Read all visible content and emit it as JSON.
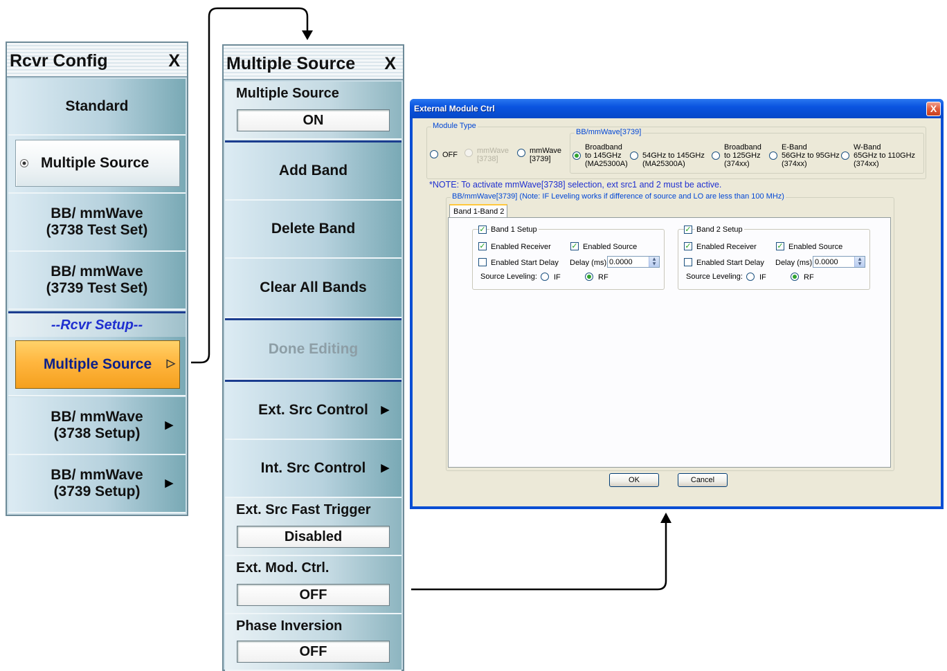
{
  "menu1": {
    "title": "Rcvr Config",
    "close": "X",
    "standard": "Standard",
    "multiple_source": "Multiple Source",
    "bb_3738_test": "BB/ mmWave\n(3738 Test Set)",
    "bb_3739_test": "BB/ mmWave\n(3739 Test Set)",
    "section_header": "--Rcvr Setup--",
    "multiple_source_setup": "Multiple Source",
    "bb_3738_setup": "BB/ mmWave\n(3738 Setup)",
    "bb_3739_setup": "BB/ mmWave\n(3739 Setup)"
  },
  "menu2": {
    "title": "Multiple Source",
    "close": "X",
    "multiple_source_label": "Multiple Source",
    "multiple_source_value": "ON",
    "add_band": "Add Band",
    "delete_band": "Delete Band",
    "clear_all_bands": "Clear All Bands",
    "done_editing": "Done Editing",
    "ext_src_control": "Ext. Src Control",
    "int_src_control": "Int. Src Control",
    "ext_src_fast_trigger_label": "Ext. Src Fast Trigger",
    "ext_src_fast_trigger_value": "Disabled",
    "ext_mod_ctrl_label": "Ext. Mod. Ctrl.",
    "ext_mod_ctrl_value": "OFF",
    "phase_inversion_label": "Phase Inversion",
    "phase_inversion_value": "OFF"
  },
  "dialog": {
    "title": "External Module Ctrl",
    "close": "X",
    "module_type": {
      "title": "Module Type",
      "off": "OFF",
      "mmwave_3738": "mmWave\n[3738]",
      "mmwave_3739": "mmWave\n[3739]"
    },
    "bb_group": {
      "title": "BB/mmWave[3739]",
      "options": [
        {
          "label": "Broadband\nto 145GHz\n(MA25300A)",
          "selected": true
        },
        {
          "label": "54GHz to 145GHz\n(MA25300A)",
          "selected": false
        },
        {
          "label": "Broadband\nto 125GHz\n(374xx)",
          "selected": false
        },
        {
          "label": "E-Band\n56GHz to 95GHz\n(374xx)",
          "selected": false
        },
        {
          "label": "W-Band\n65GHz to 110GHz\n(374xx)",
          "selected": false
        }
      ]
    },
    "note": "*NOTE: To activate mmWave[3738] selection, ext src1 and 2 must be active.",
    "bb_frame_title": "BB/mmWave[3739]   (Note: IF Leveling works if difference of source and LO are less than 100 MHz)",
    "tab": "Band 1-Band 2",
    "band1": {
      "setup": "Band 1 Setup",
      "enabled_receiver": "Enabled Receiver",
      "enabled_source": "Enabled Source",
      "enabled_start_delay": "Enabled Start Delay",
      "delay_label": "Delay (ms) :",
      "delay_value": "0.0000",
      "source_leveling": "Source Leveling:",
      "if": "IF",
      "rf": "RF"
    },
    "band2": {
      "setup": "Band 2 Setup",
      "enabled_receiver": "Enabled Receiver",
      "enabled_source": "Enabled Source",
      "enabled_start_delay": "Enabled Start Delay",
      "delay_label": "Delay (ms) :",
      "delay_value": "0.0000",
      "source_leveling": "Source Leveling:",
      "if": "IF",
      "rf": "RF"
    },
    "ok": "OK",
    "cancel": "Cancel"
  },
  "colors": {
    "active_item": "#ffb63f",
    "section_header_text": "#1f2fd0",
    "dialog_title_bar": "#0a54e0",
    "note_text": "#1f2fd0"
  }
}
